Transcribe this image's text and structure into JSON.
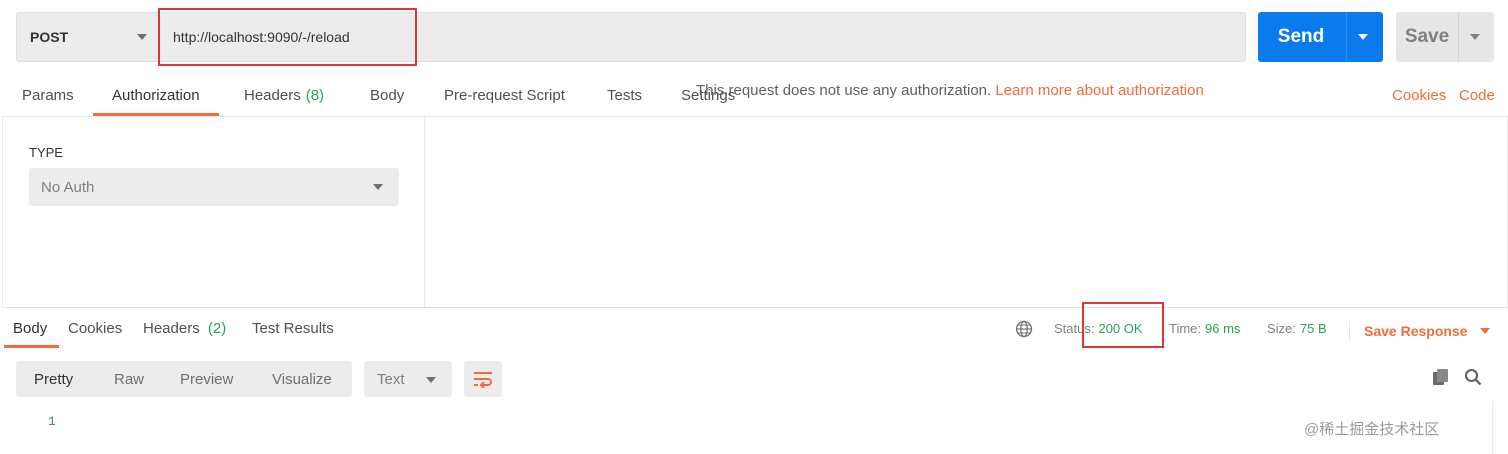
{
  "request": {
    "method": "POST",
    "url": "http://localhost:9090/-/reload",
    "send_label": "Send",
    "save_label": "Save"
  },
  "request_tabs": [
    {
      "label": "Params",
      "count": ""
    },
    {
      "label": "Authorization",
      "count": "",
      "active": true
    },
    {
      "label": "Headers",
      "count": "(8)"
    },
    {
      "label": "Body",
      "count": ""
    },
    {
      "label": "Pre-request Script",
      "count": ""
    },
    {
      "label": "Tests",
      "count": ""
    },
    {
      "label": "Settings",
      "count": ""
    }
  ],
  "request_links": {
    "cookies": "Cookies",
    "code": "Code"
  },
  "authorization": {
    "type_label": "TYPE",
    "selected_type": "No Auth",
    "message": "This request does not use any authorization.",
    "learn_more": "Learn more about authorization"
  },
  "response_tabs": [
    {
      "label": "Body",
      "count": "",
      "active": true
    },
    {
      "label": "Cookies",
      "count": ""
    },
    {
      "label": "Headers",
      "count": "(2)"
    },
    {
      "label": "Test Results",
      "count": ""
    }
  ],
  "response_meta": {
    "status_label": "Status:",
    "status_value": "200 OK",
    "time_label": "Time:",
    "time_value": "96 ms",
    "size_label": "Size:",
    "size_value": "75 B",
    "save_response": "Save Response"
  },
  "body_view": {
    "options": [
      "Pretty",
      "Raw",
      "Preview",
      "Visualize"
    ],
    "active": "Pretty",
    "format": "Text"
  },
  "code": {
    "line_number": "1"
  },
  "watermark": "@稀土掘金技术社区",
  "colors": {
    "accent": "#f26b3a",
    "send": "#097bed",
    "success": "#26a35b",
    "highlight": "#d9363e"
  },
  "icons": [
    "chevron-down-icon",
    "globe-icon",
    "wrap-lines-icon",
    "copy-icon",
    "search-icon"
  ]
}
